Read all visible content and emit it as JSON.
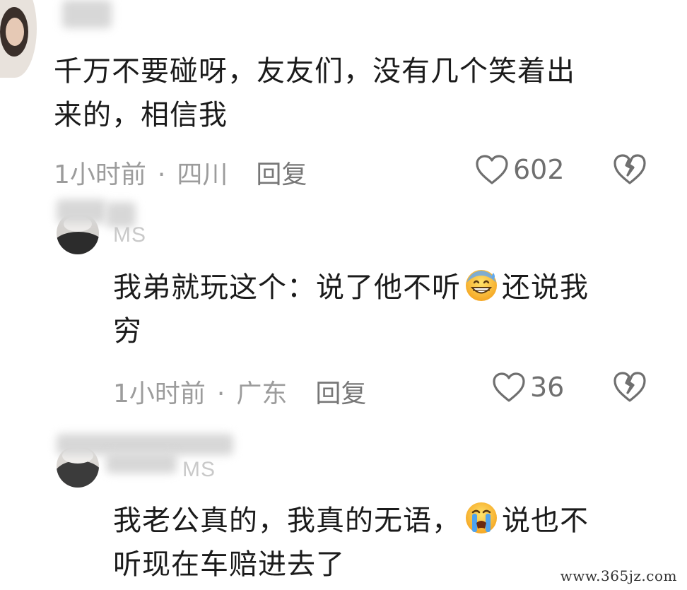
{
  "comments": [
    {
      "text_line1": "千万不要碰呀，友友们，没有几个笑着出",
      "text_line2": "来的，相信我",
      "time": "1小时前",
      "dot": "·",
      "location": "四川",
      "reply_label": "回复",
      "likes": "602"
    },
    {
      "username_fragment": "MS",
      "text_line1_a": "我弟就玩这个：说了他不听",
      "emoji": "grinning-sweat-emoji",
      "text_line1_b": "还说我",
      "text_line2": "穷",
      "time": "1小时前",
      "dot": "·",
      "location": "广东",
      "reply_label": "回复",
      "likes": "36"
    },
    {
      "username_fragment": "MS",
      "text_line1_a": "我老公真的，我真的无语，",
      "emoji": "loudly-crying-emoji",
      "text_line1_b": "说也不",
      "text_line2": "听现在车赔进去了"
    }
  ],
  "icons": {
    "like": "heart-outline-icon",
    "dislike": "broken-heart-icon"
  },
  "watermark": "www.365jz.com"
}
